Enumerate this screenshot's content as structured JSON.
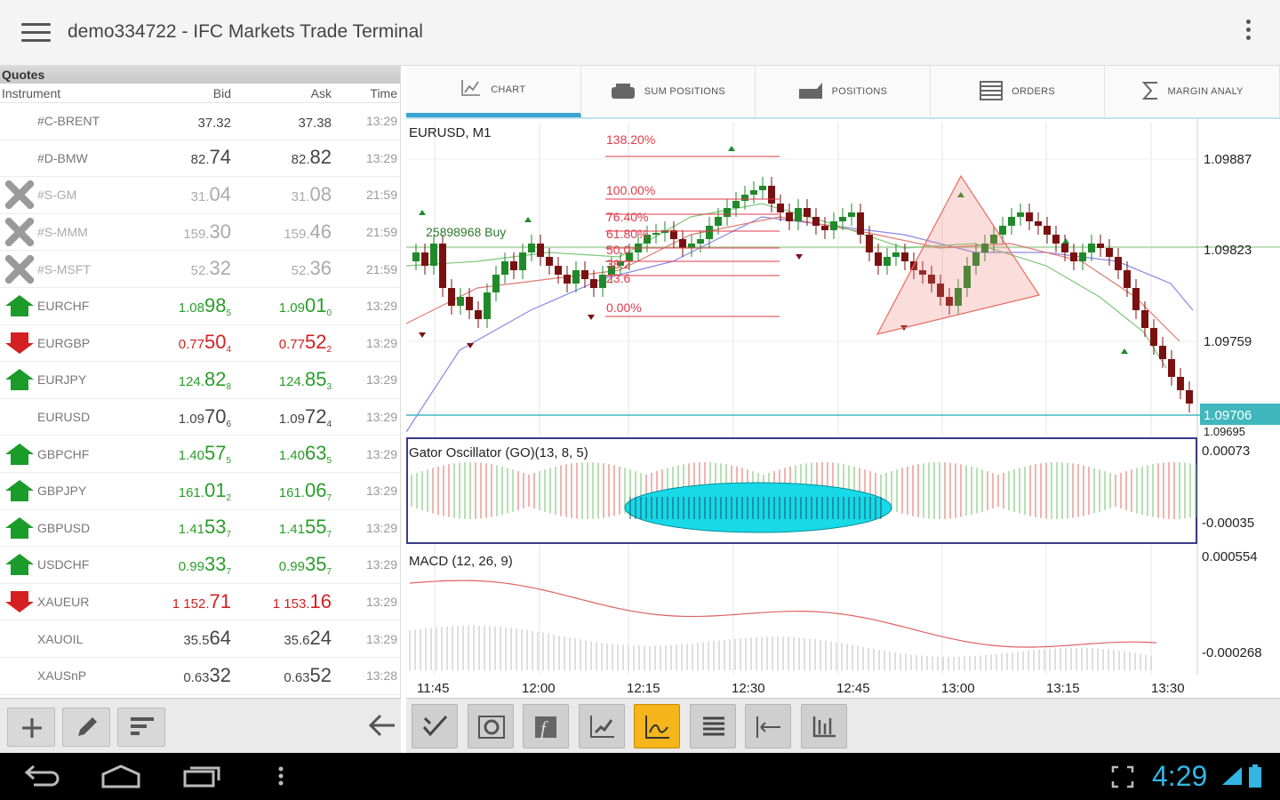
{
  "app": {
    "title": "demo334722 - IFC Markets Trade Terminal"
  },
  "quotes": {
    "title": "Quotes",
    "headers": {
      "instrument": "Instrument",
      "bid": "Bid",
      "ask": "Ask",
      "time": "Time"
    },
    "rows": [
      {
        "icon": "none",
        "state": "neutral",
        "name": "#C-BRENT",
        "bid_pre": "37.32",
        "bid_big": "",
        "bid_suf": "",
        "ask_pre": "37.38",
        "ask_big": "",
        "ask_suf": "",
        "time": "13:29"
      },
      {
        "icon": "none",
        "state": "neutral",
        "name": "#D-BMW",
        "bid_pre": "82.",
        "bid_big": "74",
        "bid_suf": "",
        "ask_pre": "82.",
        "ask_big": "82",
        "ask_suf": "",
        "time": "13:29"
      },
      {
        "icon": "closed",
        "state": "closed",
        "name": "#S-GM",
        "bid_pre": "31.",
        "bid_big": "04",
        "bid_suf": "",
        "ask_pre": "31.",
        "ask_big": "08",
        "ask_suf": "",
        "time": "21:59"
      },
      {
        "icon": "closed",
        "state": "closed",
        "name": "#S-MMM",
        "bid_pre": "159.",
        "bid_big": "30",
        "bid_suf": "",
        "ask_pre": "159.",
        "ask_big": "46",
        "ask_suf": "",
        "time": "21:59"
      },
      {
        "icon": "closed",
        "state": "closed",
        "name": "#S-MSFT",
        "bid_pre": "52.",
        "bid_big": "32",
        "bid_suf": "",
        "ask_pre": "52.",
        "ask_big": "36",
        "ask_suf": "",
        "time": "21:59"
      },
      {
        "icon": "up",
        "state": "up",
        "name": "EURCHF",
        "bid_pre": "1.08",
        "bid_big": "98",
        "bid_suf": "5",
        "ask_pre": "1.09",
        "ask_big": "01",
        "ask_suf": "0",
        "time": "13:29"
      },
      {
        "icon": "down",
        "state": "down",
        "name": "EURGBP",
        "bid_pre": "0.77",
        "bid_big": "50",
        "bid_suf": "4",
        "ask_pre": "0.77",
        "ask_big": "52",
        "ask_suf": "2",
        "time": "13:29"
      },
      {
        "icon": "up",
        "state": "up",
        "name": "EURJPY",
        "bid_pre": "124.",
        "bid_big": "82",
        "bid_suf": "8",
        "ask_pre": "124.",
        "ask_big": "85",
        "ask_suf": "3",
        "time": "13:29"
      },
      {
        "icon": "none",
        "state": "neutral",
        "name": "EURUSD",
        "bid_pre": "1.09",
        "bid_big": "70",
        "bid_suf": "6",
        "ask_pre": "1.09",
        "ask_big": "72",
        "ask_suf": "4",
        "time": "13:29"
      },
      {
        "icon": "up",
        "state": "up",
        "name": "GBPCHF",
        "bid_pre": "1.40",
        "bid_big": "57",
        "bid_suf": "5",
        "ask_pre": "1.40",
        "ask_big": "63",
        "ask_suf": "5",
        "time": "13:29"
      },
      {
        "icon": "up",
        "state": "up",
        "name": "GBPJPY",
        "bid_pre": "161.",
        "bid_big": "01",
        "bid_suf": "2",
        "ask_pre": "161.",
        "ask_big": "06",
        "ask_suf": "7",
        "time": "13:29"
      },
      {
        "icon": "up",
        "state": "up",
        "name": "GBPUSD",
        "bid_pre": "1.41",
        "bid_big": "53",
        "bid_suf": "7",
        "ask_pre": "1.41",
        "ask_big": "55",
        "ask_suf": "7",
        "time": "13:29"
      },
      {
        "icon": "up",
        "state": "up",
        "name": "USDCHF",
        "bid_pre": "0.99",
        "bid_big": "33",
        "bid_suf": "7",
        "ask_pre": "0.99",
        "ask_big": "35",
        "ask_suf": "7",
        "time": "13:29"
      },
      {
        "icon": "down",
        "state": "down",
        "name": "XAUEUR",
        "bid_pre": "1 152.",
        "bid_big": "71",
        "bid_suf": "",
        "ask_pre": "1 153.",
        "ask_big": "16",
        "ask_suf": "",
        "time": "13:29"
      },
      {
        "icon": "none",
        "state": "neutral",
        "name": "XAUOIL",
        "bid_pre": "35.5",
        "bid_big": "64",
        "bid_suf": "",
        "ask_pre": "35.6",
        "ask_big": "24",
        "ask_suf": "",
        "time": "13:29"
      },
      {
        "icon": "none",
        "state": "neutral",
        "name": "XAUSnP",
        "bid_pre": "0.63",
        "bid_big": "32",
        "bid_suf": "",
        "ask_pre": "0.63",
        "ask_big": "52",
        "ask_suf": "",
        "time": "13:28"
      }
    ]
  },
  "tabs": [
    {
      "label": "CHART",
      "icon": "chart-icon",
      "active": true
    },
    {
      "label": "SUM POSITIONS",
      "icon": "sum-positions-icon",
      "active": false
    },
    {
      "label": "POSITIONS",
      "icon": "positions-icon",
      "active": false
    },
    {
      "label": "ORDERS",
      "icon": "orders-icon",
      "active": false
    },
    {
      "label": "MARGIN ANALY",
      "icon": "sigma-icon",
      "active": false
    }
  ],
  "chart": {
    "symbol": "EURUSD, M1",
    "order_label": "25898968 Buy",
    "fib_labels": [
      "138.20%",
      "100.00%",
      "76.40%",
      "61.80%",
      "50.0",
      "38.2",
      "23.6",
      "0.00%"
    ],
    "price_labels": [
      "1.09887",
      "1.09823",
      "1.09759",
      "1.09706",
      "1.09695"
    ],
    "current_price": "1.09706",
    "gator_title": "Gator Oscillator (GO)(13, 8, 5)",
    "gator_labels": [
      "0.00073",
      "-0.00035"
    ],
    "macd_title": "MACD (12, 26, 9)",
    "macd_labels": [
      "0.000554",
      "-0.000268"
    ],
    "time_labels": [
      "11:45",
      "12:00",
      "12:15",
      "12:30",
      "12:45",
      "13:00",
      "13:15",
      "13:30"
    ],
    "colors": {
      "bull": "#1f8a2a",
      "bear": "#7a1111",
      "fib": "#e03a4a",
      "current": "#3fb7bd",
      "pane_border": "#3a3a8a",
      "ellipse": "#18d9e6"
    }
  },
  "chart_toolbar": [
    {
      "icon": "crosshair-check-icon",
      "active": false
    },
    {
      "icon": "zoom-icon",
      "active": false
    },
    {
      "icon": "function-icon",
      "active": false
    },
    {
      "icon": "chart-edit-icon",
      "active": false
    },
    {
      "icon": "chart-type-icon",
      "active": true
    },
    {
      "icon": "list-icon",
      "active": false
    },
    {
      "icon": "scale-fit-icon",
      "active": false
    },
    {
      "icon": "bar-chart-icon",
      "active": false
    }
  ],
  "status": {
    "clock": "4:29"
  }
}
